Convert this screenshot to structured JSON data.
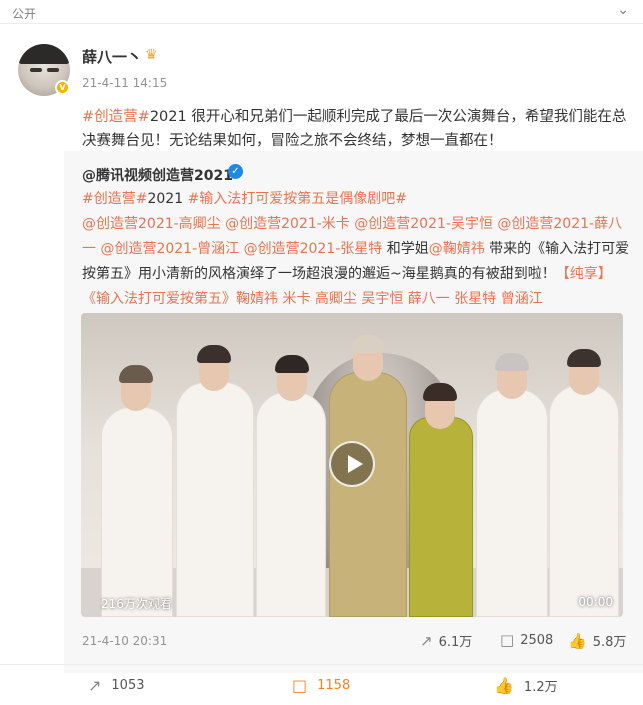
{
  "header": {
    "visibility": "公开",
    "more_icon": "chevron-down-icon"
  },
  "post": {
    "author": "薛八一丶",
    "badge_icon": "crown-icon",
    "time": "21-4-11 14:15",
    "text_tag": "#创造营#",
    "text_body": "2021 很开心和兄弟们一起顺利完成了最后一次公演舞台，希望我们能在总决赛舞台见！无论结果如何，冒险之旅不会终结，梦想一直都在！"
  },
  "repost": {
    "author": "@腾讯视频创造营2021",
    "tag1": "#创造营#",
    "tag1_tail": "2021",
    "tag2": "#输入法打可爱按第五是偶像剧吧#",
    "mentions": "@创造营2021-高卿尘 @创造营2021-米卡 @创造营2021-吴宇恒 @创造营2021-薛八一 @创造营2021-曾涵江 @创造营2021-张星特",
    "and_sister": " 和学姐",
    "mention_ju": "@鞠婧祎",
    "desc": " 带来的《输入法打可爱按第五》用小清新的风格演绎了一场超浪漫的邂逅~海星鹅真的有被甜到啦！",
    "link": "【纯享】《输入法打可爱按第五》鞠婧祎 米卡 高卿尘 吴宇恒 薛八一 张星特 曾涵江",
    "video": {
      "views": "216万次观看",
      "duration": "00:00"
    },
    "time": "21-4-10 20:31",
    "actions": {
      "share": "6.1万",
      "comment": "2508",
      "like": "5.8万"
    }
  },
  "actions": {
    "share": "1053",
    "comment": "1158",
    "like": "1.2万"
  },
  "colors": {
    "accent": "#eb7350",
    "comment_active": "#f58220",
    "verified_blue": "#1e88e5"
  }
}
